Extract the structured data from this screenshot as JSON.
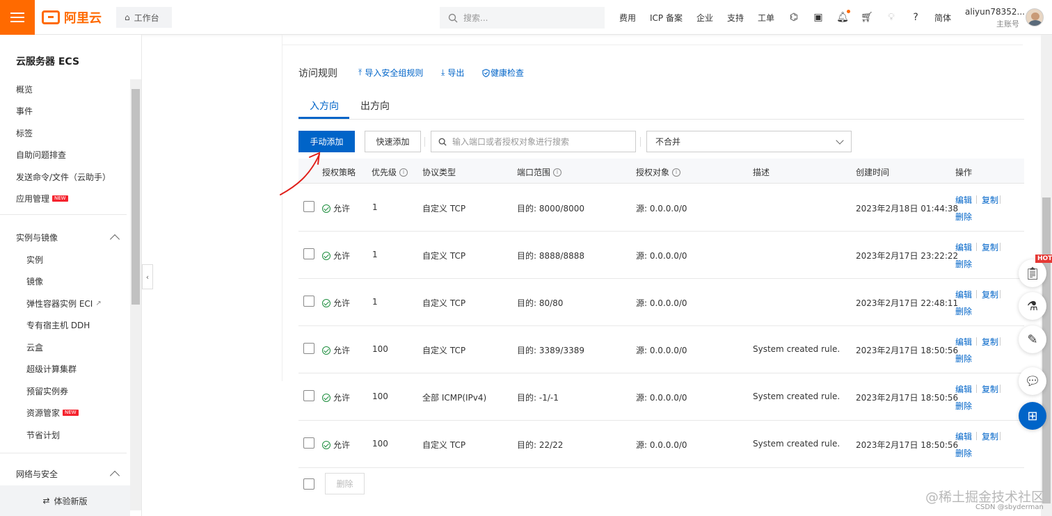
{
  "header": {
    "logo_text": "阿里云",
    "workbench_label": "工作台",
    "search_placeholder": "搜索...",
    "nav": [
      "费用",
      "ICP 备案",
      "企业",
      "支持",
      "工单"
    ],
    "lang": "简体",
    "account_name": "aliyun78352...",
    "account_type": "主账号"
  },
  "sidebar": {
    "title": "云服务器 ECS",
    "items": [
      "概览",
      "事件",
      "标签",
      "自助问题排查",
      "发送命令/文件（云助手）",
      "应用管理"
    ],
    "new_badge": "NEW",
    "group1": "实例与镜像",
    "group1_items": [
      "实例",
      "镜像",
      "弹性容器实例 ECI",
      "专有宿主机 DDH",
      "云盒",
      "超级计算集群",
      "预留实例券",
      "资源管家",
      "节省计划"
    ],
    "group2": "网络与安全",
    "footer": "体验新版"
  },
  "rules": {
    "title": "访问规则",
    "import_label": "导入安全组规则",
    "export_label": "导出",
    "health_label": "健康检查",
    "tab_in": "入方向",
    "tab_out": "出方向",
    "manual_add": "手动添加",
    "quick_add": "快速添加",
    "filter_placeholder": "输入端口或者授权对象进行搜索",
    "merge_select": "不合并",
    "columns": [
      "授权策略",
      "优先级",
      "协议类型",
      "端口范围",
      "授权对象",
      "描述",
      "创建时间",
      "操作"
    ],
    "rows": [
      {
        "policy": "允许",
        "priority": "1",
        "protocol": "自定义 TCP",
        "port": "目的: 8000/8000",
        "source": "源: 0.0.0.0/0",
        "desc": "",
        "time": "2023年2月18日 01:44:38"
      },
      {
        "policy": "允许",
        "priority": "1",
        "protocol": "自定义 TCP",
        "port": "目的: 8888/8888",
        "source": "源: 0.0.0.0/0",
        "desc": "",
        "time": "2023年2月17日 23:22:22"
      },
      {
        "policy": "允许",
        "priority": "1",
        "protocol": "自定义 TCP",
        "port": "目的: 80/80",
        "source": "源: 0.0.0.0/0",
        "desc": "",
        "time": "2023年2月17日 22:48:11"
      },
      {
        "policy": "允许",
        "priority": "100",
        "protocol": "自定义 TCP",
        "port": "目的: 3389/3389",
        "source": "源: 0.0.0.0/0",
        "desc": "System created rule.",
        "time": "2023年2月17日 18:50:56"
      },
      {
        "policy": "允许",
        "priority": "100",
        "protocol": "全部 ICMP(IPv4)",
        "port": "目的: -1/-1",
        "source": "源: 0.0.0.0/0",
        "desc": "System created rule.",
        "time": "2023年2月17日 18:50:56"
      },
      {
        "policy": "允许",
        "priority": "100",
        "protocol": "自定义 TCP",
        "port": "目的: 22/22",
        "source": "源: 0.0.0.0/0",
        "desc": "System created rule.",
        "time": "2023年2月17日 18:50:56"
      }
    ],
    "edit": "编辑",
    "copy": "复制",
    "delete": "删除",
    "batch_delete": "删除"
  },
  "floating": {
    "hot": "HOT"
  },
  "watermark": {
    "main": "@稀土掘金技术社区",
    "sub": "CSDN @sbyderman"
  },
  "colors": {
    "brand": "#ff6a00",
    "primary": "#0064c8",
    "success": "#1e8e3e"
  }
}
